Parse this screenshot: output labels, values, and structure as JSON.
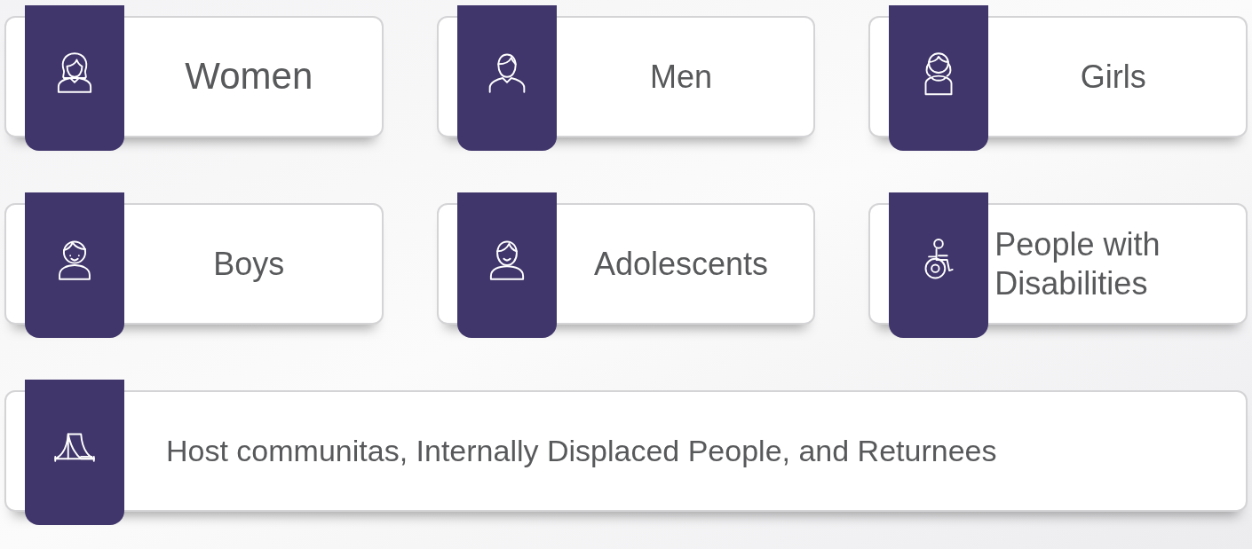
{
  "groups": [
    {
      "label": "Women",
      "kind": "woman",
      "wide": false
    },
    {
      "label": "Men",
      "kind": "man",
      "wide": false
    },
    {
      "label": "Girls",
      "kind": "girl",
      "wide": false
    },
    {
      "label": "Boys",
      "kind": "boy",
      "wide": false
    },
    {
      "label": "Adolescents",
      "kind": "adolescent",
      "wide": false
    },
    {
      "label": "People with Disabilities",
      "kind": "wheelchair",
      "wide": false
    },
    {
      "label": "Host communitas, Internally Displaced People, and Returnees",
      "kind": "tent",
      "wide": true
    }
  ]
}
